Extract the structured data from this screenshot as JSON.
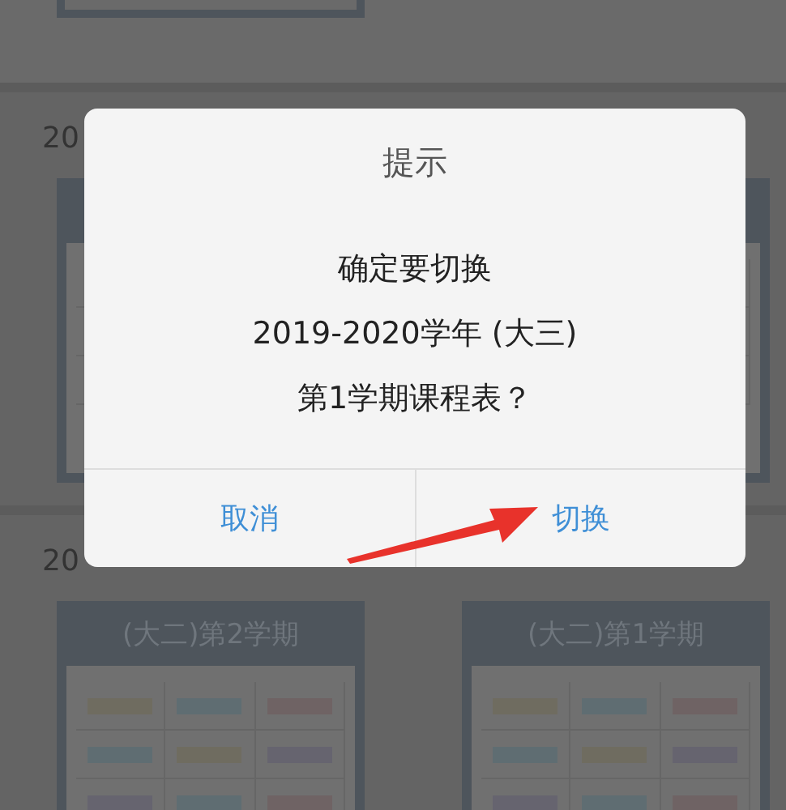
{
  "sections": [
    {
      "cards": [
        {
          "kind": "stub"
        }
      ]
    },
    {
      "title": "20",
      "cards": [
        {
          "kind": "card"
        },
        {
          "kind": "card"
        }
      ]
    },
    {
      "title": "20",
      "cards": [
        {
          "title": "(大二)第2学期",
          "kind": "card"
        },
        {
          "title": "(大二)第1学期",
          "kind": "card"
        }
      ]
    }
  ],
  "dialog": {
    "title": "提示",
    "message_lines": [
      "确定要切换",
      "2019-2020学年 (大三)",
      "第1学期课程表？"
    ],
    "buttons": [
      {
        "label": "取消",
        "kind": "cancel"
      },
      {
        "label": "切换",
        "kind": "confirm"
      }
    ]
  }
}
